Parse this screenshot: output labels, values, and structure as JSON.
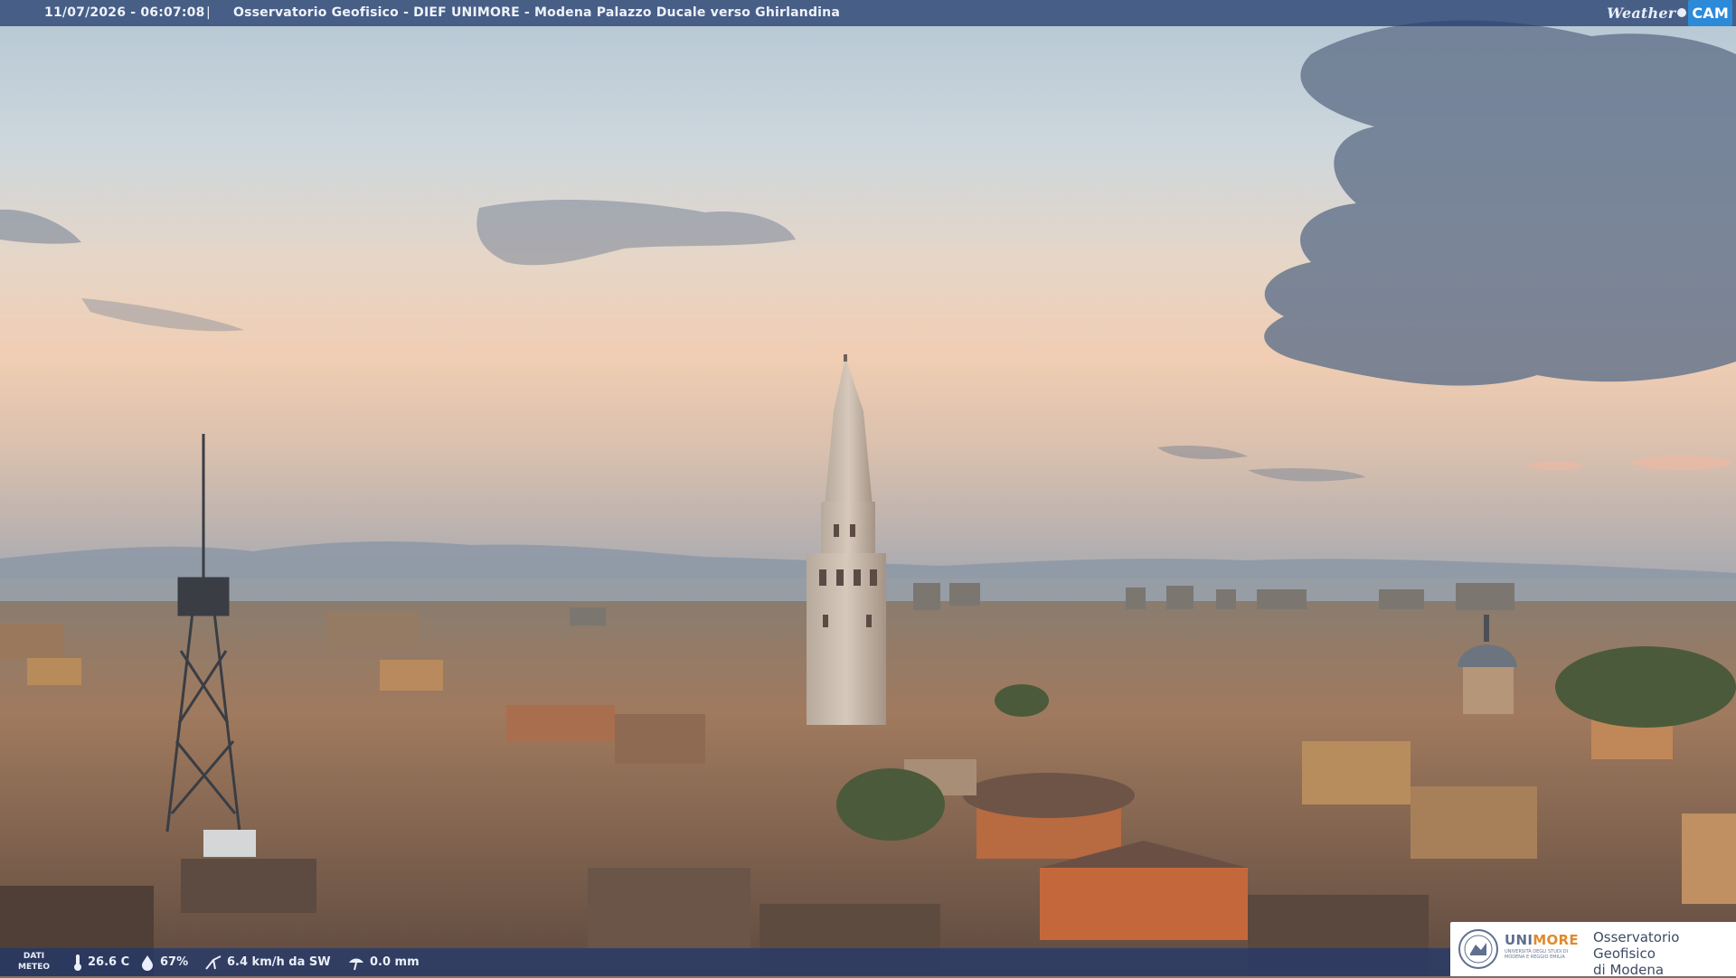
{
  "header": {
    "datetime": "11/07/2026 - 06:07:08",
    "separator": "|",
    "title": "Osservatorio Geofisico - DIEF UNIMORE - Modena Palazzo Ducale verso Ghirlandina",
    "logo_part1": "Weather",
    "logo_part2": "CAM"
  },
  "weather": {
    "label_line1": "DATI",
    "label_line2": "METEO",
    "temperature": "26.6 C",
    "humidity": "67%",
    "wind": "6.4 km/h da SW",
    "rain": "0.0 mm",
    "icons": [
      "thermometer-icon",
      "humidity-drop-icon",
      "wind-icon",
      "rain-gauge-icon"
    ]
  },
  "footer_logo": {
    "unimore_part1": "UNI",
    "unimore_part2": "MORE",
    "university_line": "UNIVERSITÀ DEGLI STUDI DI MODENA E REGGIO EMILIA",
    "observatory_line1": "Osservatorio Geofisico",
    "observatory_line2": "di Modena"
  },
  "colors": {
    "sky_top": "#b6c8d6",
    "sky_horizon": "#f2cfb4",
    "clouds": "#5f6f86",
    "roofs": "#8a6a55",
    "overlay_bar": "#284070",
    "accent_orange": "#e08a2c"
  }
}
